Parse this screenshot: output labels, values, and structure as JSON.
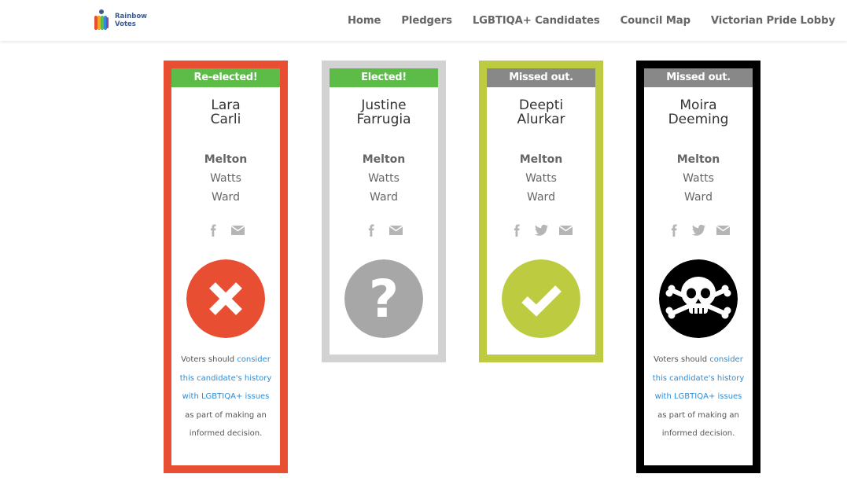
{
  "header": {
    "logo": {
      "line1": "Rainbow",
      "line2": "Votes"
    },
    "nav": [
      "Home",
      "Pledgers",
      "LGBTIQA+ Candidates",
      "Council Map",
      "Victorian Pride Lobby"
    ]
  },
  "candidates": [
    {
      "status": "Re-elected!",
      "first_name": "Lara",
      "last_name": "Carli",
      "ward_line1": "Melton",
      "ward_line2": "Watts",
      "ward_line3": "Ward",
      "social": [
        "facebook-icon",
        "email-icon"
      ],
      "verdict_icon": "cross-icon",
      "note": {
        "before": "Voters should ",
        "link": "consider this candidate's history with LGBTIQA+ issues",
        "after": " as part of making an informed decision."
      },
      "colors": {
        "border": "#e84e32",
        "status_bg": "#5cbc47",
        "verdict": "#e84e32"
      }
    },
    {
      "status": "Elected!",
      "first_name": "Justine",
      "last_name": "Farrugia",
      "ward_line1": "Melton",
      "ward_line2": "Watts",
      "ward_line3": "Ward",
      "social": [
        "facebook-icon",
        "email-icon"
      ],
      "verdict_icon": "question-icon",
      "colors": {
        "border": "#d2d2d2",
        "status_bg": "#5cbc47",
        "verdict": "#a7a7a7"
      }
    },
    {
      "status": "Missed out.",
      "first_name": "Deepti",
      "last_name": "Alurkar",
      "ward_line1": "Melton",
      "ward_line2": "Watts",
      "ward_line3": "Ward",
      "social": [
        "facebook-icon",
        "twitter-icon",
        "email-icon"
      ],
      "verdict_icon": "check-icon",
      "colors": {
        "border": "#bccb3f",
        "status_bg": "#888888",
        "verdict": "#bccb3f"
      }
    },
    {
      "status": "Missed out.",
      "first_name": "Moira",
      "last_name": "Deeming",
      "ward_line1": "Melton",
      "ward_line2": "Watts",
      "ward_line3": "Ward",
      "social": [
        "facebook-icon",
        "twitter-icon",
        "email-icon"
      ],
      "verdict_icon": "skull-crossbones-icon",
      "note": {
        "before": "Voters should ",
        "link": "consider this candidate's history with LGBTIQA+ issues",
        "after": " as part of making an informed decision."
      },
      "colors": {
        "border": "#000000",
        "status_bg": "#888888",
        "verdict": "#000000"
      }
    }
  ]
}
